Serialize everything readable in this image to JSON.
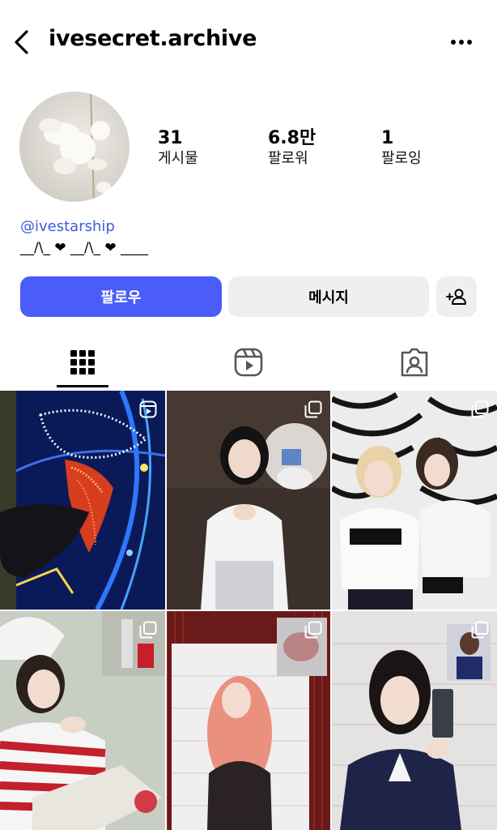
{
  "header": {
    "title": "ivesecret.archive"
  },
  "profile": {
    "stats": [
      {
        "value": "31",
        "label": "게시물"
      },
      {
        "value": "6.8만",
        "label": "팔로워"
      },
      {
        "value": "1",
        "label": "팔로잉"
      }
    ],
    "handle": "@ivestarship",
    "bio": "__/\\_ ❤ __/\\_ ❤ ____"
  },
  "actions": {
    "follow_label": "팔로우",
    "message_label": "메시지"
  },
  "tabs": [
    {
      "name": "grid",
      "icon": "grid-icon",
      "active": true
    },
    {
      "name": "reels",
      "icon": "reels-icon",
      "active": false
    },
    {
      "name": "tagged",
      "icon": "tagged-icon",
      "active": false
    }
  ],
  "posts": [
    {
      "type": "reel",
      "icon": "reel-badge-icon"
    },
    {
      "type": "carousel",
      "icon": "carousel-icon"
    },
    {
      "type": "carousel",
      "icon": "carousel-icon"
    },
    {
      "type": "carousel",
      "icon": "carousel-icon"
    },
    {
      "type": "carousel",
      "icon": "carousel-icon"
    },
    {
      "type": "carousel",
      "icon": "carousel-icon"
    }
  ],
  "colors": {
    "accent": "#4a5df9",
    "link": "#3b5bdb",
    "secondary_button": "#efefef"
  }
}
